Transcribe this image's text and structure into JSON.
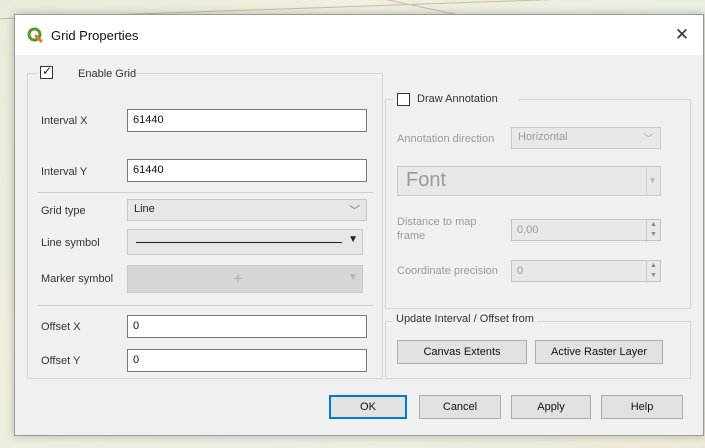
{
  "dialog": {
    "title": "Grid Properties",
    "close_glyph": "✕",
    "accent_color": "#589632"
  },
  "grid": {
    "enable_label": "Enable Grid",
    "enabled": true,
    "interval_x_label": "Interval X",
    "interval_x_value": "61440",
    "interval_y_label": "Interval Y",
    "interval_y_value": "61440",
    "grid_type_label": "Grid type",
    "grid_type_value": "Line",
    "line_symbol_label": "Line symbol",
    "marker_symbol_label": "Marker symbol",
    "marker_symbol_glyph": "+",
    "offset_x_label": "Offset X",
    "offset_x_value": "0",
    "offset_y_label": "Offset Y",
    "offset_y_value": "0"
  },
  "annotation": {
    "draw_label": "Draw Annotation",
    "draw_checked": false,
    "direction_label": "Annotation direction",
    "direction_value": "Horizontal",
    "font_label": "Font",
    "distance_label_line1": "Distance to map",
    "distance_label_line2": "frame",
    "distance_value": "0,00",
    "precision_label": "Coordinate precision",
    "precision_value": "0"
  },
  "update": {
    "title": "Update Interval / Offset from",
    "canvas_extents_label": "Canvas Extents",
    "active_raster_label": "Active Raster Layer"
  },
  "buttons": {
    "ok": "OK",
    "cancel": "Cancel",
    "apply": "Apply",
    "help": "Help"
  }
}
